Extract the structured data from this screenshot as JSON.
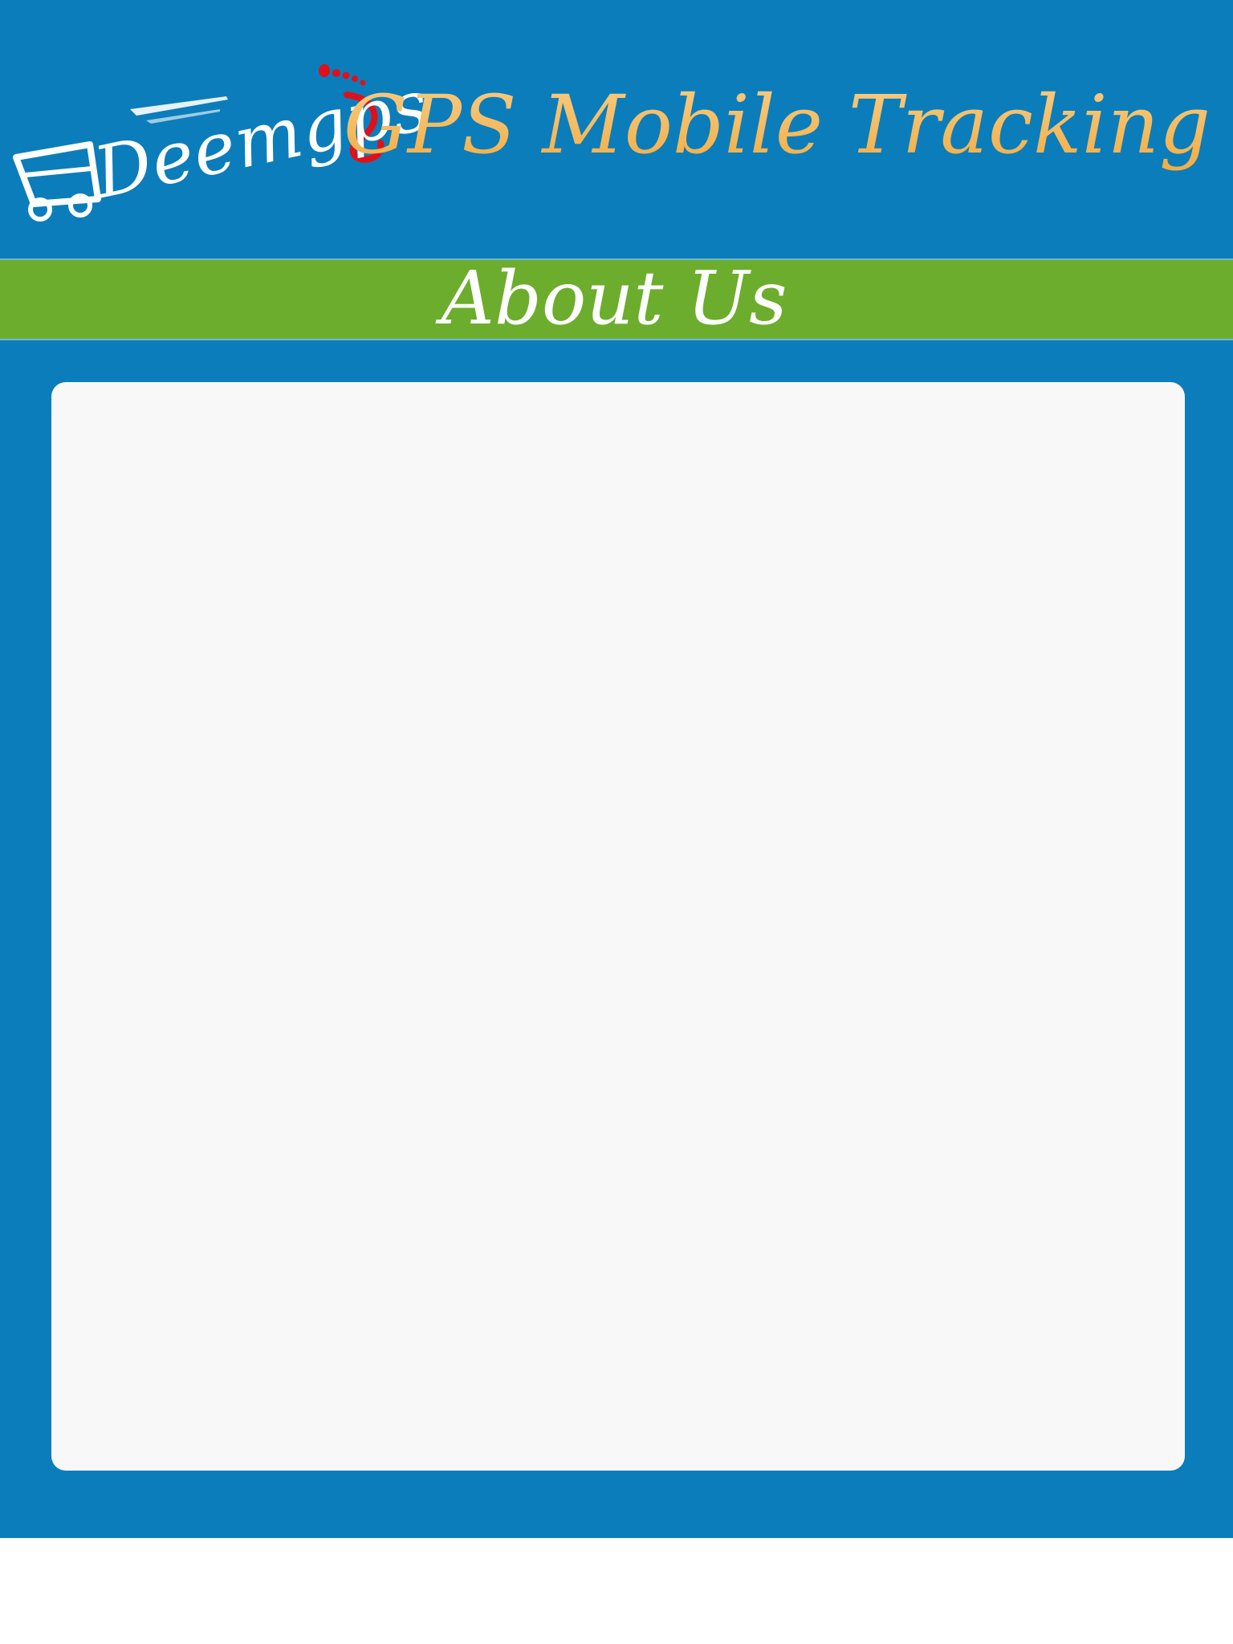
{
  "header": {
    "logo_text": "Deemgps",
    "logo_icon": "vehicle-footprint-icon",
    "title": "GPS Mobile Tracking"
  },
  "section": {
    "title": "About Us"
  },
  "colors": {
    "background": "#0c7dbb",
    "section_bar": "#6dad2e",
    "title_gold": "#f4b65a",
    "card": "#f8f8f8",
    "logo_accent": "#e0101b"
  }
}
